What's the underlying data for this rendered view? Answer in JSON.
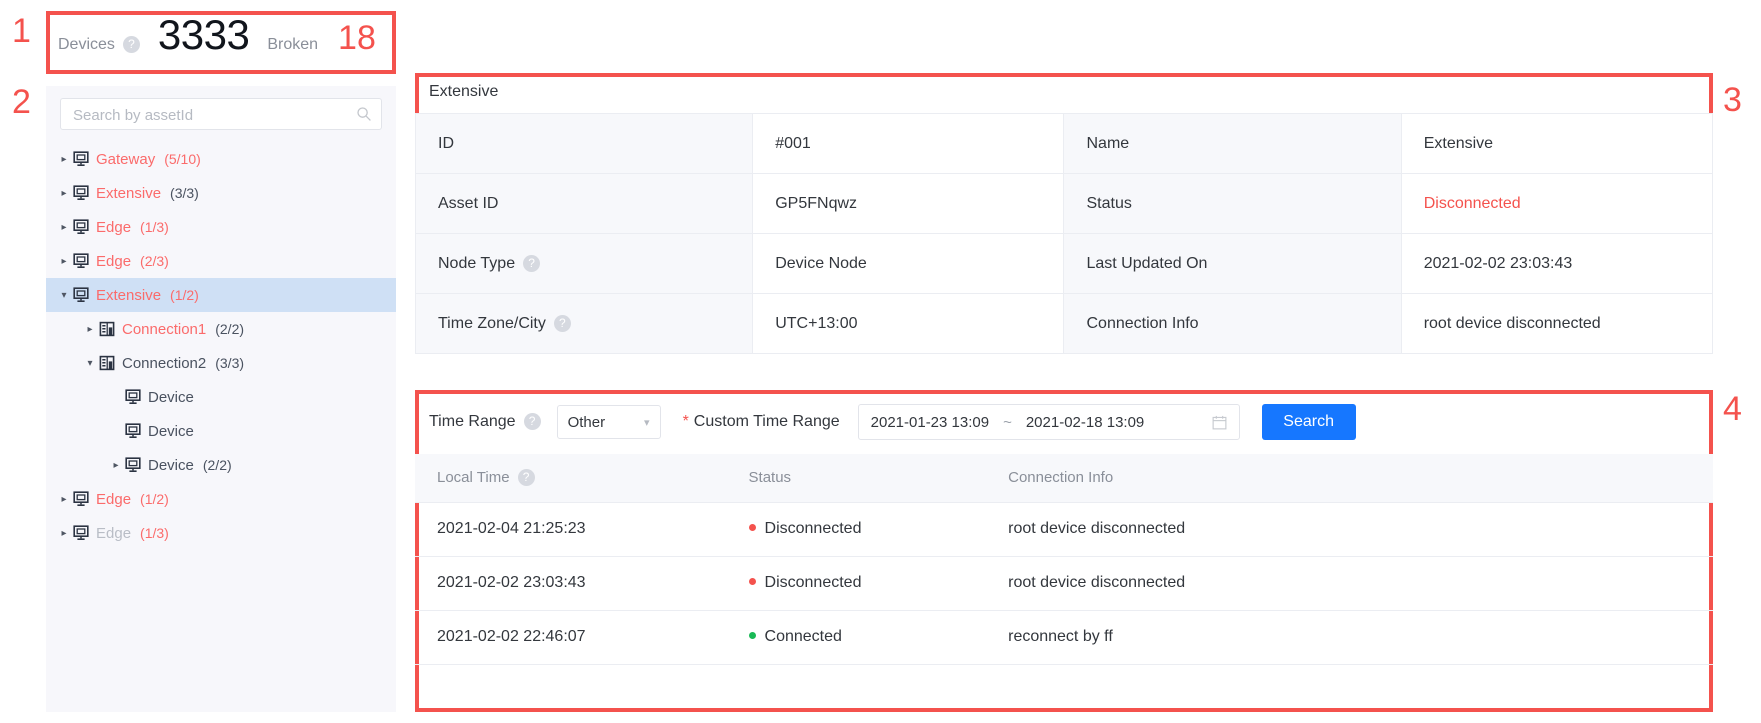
{
  "annotations": [
    {
      "num": "1"
    },
    {
      "num": "2"
    },
    {
      "num": "3"
    },
    {
      "num": "4"
    }
  ],
  "summary": {
    "devices_label": "Devices",
    "help_glyph": "?",
    "devices_count": "3333",
    "broken_label": "Broken",
    "broken_count": "18",
    "broken_color": "#f4524d"
  },
  "sidebar": {
    "search": {
      "placeholder": "Search by assetId",
      "value": "",
      "icon": "search-icon"
    },
    "tree": [
      {
        "label": "Gateway",
        "count": "(5/10)",
        "depth": 0,
        "caret": "right",
        "icon": "device-icon",
        "label_color": "red",
        "count_color": "red",
        "selected": false
      },
      {
        "label": "Extensive",
        "count": "(3/3)",
        "depth": 0,
        "caret": "right",
        "icon": "device-icon",
        "label_color": "red",
        "count_color": "dark",
        "selected": false
      },
      {
        "label": "Edge",
        "count": "(1/3)",
        "depth": 0,
        "caret": "right",
        "icon": "device-icon",
        "label_color": "red",
        "count_color": "red",
        "selected": false
      },
      {
        "label": "Edge",
        "count": "(2/3)",
        "depth": 0,
        "caret": "right",
        "icon": "device-icon",
        "label_color": "red",
        "count_color": "red",
        "selected": false
      },
      {
        "label": "Extensive",
        "count": "(1/2)",
        "depth": 0,
        "caret": "down",
        "icon": "device-icon",
        "label_color": "red",
        "count_color": "red",
        "selected": true
      },
      {
        "label": "Connection1",
        "count": "(2/2)",
        "depth": 1,
        "caret": "right",
        "icon": "connection-icon",
        "label_color": "red",
        "count_color": "dark",
        "selected": false
      },
      {
        "label": "Connection2",
        "count": "(3/3)",
        "depth": 1,
        "caret": "down",
        "icon": "connection-icon",
        "label_color": "dark",
        "count_color": "dark",
        "selected": false
      },
      {
        "label": "Device",
        "count": "",
        "depth": 2,
        "caret": "none",
        "icon": "device-icon",
        "label_color": "dark",
        "count_color": "dark",
        "selected": false
      },
      {
        "label": "Device",
        "count": "",
        "depth": 2,
        "caret": "none",
        "icon": "device-icon",
        "label_color": "dark",
        "count_color": "dark",
        "selected": false
      },
      {
        "label": "Device",
        "count": "(2/2)",
        "depth": 2,
        "caret": "right",
        "icon": "device-icon",
        "label_color": "dark",
        "count_color": "dark",
        "selected": false
      },
      {
        "label": "Edge",
        "count": "(1/2)",
        "depth": 0,
        "caret": "right",
        "icon": "device-icon",
        "label_color": "red",
        "count_color": "red",
        "selected": false
      },
      {
        "label": "Edge",
        "count": "(1/3)",
        "depth": 0,
        "caret": "right",
        "icon": "device-icon",
        "label_color": "gray",
        "count_color": "red",
        "selected": false
      }
    ]
  },
  "detail": {
    "title": "Extensive",
    "rows": [
      {
        "k1": "ID",
        "k1_help": false,
        "v1": "#001",
        "v1_danger": false,
        "k2": "Name",
        "v2": "Extensive",
        "v2_danger": false
      },
      {
        "k1": "Asset ID",
        "k1_help": false,
        "v1": "GP5FNqwz",
        "v1_danger": false,
        "k2": "Status",
        "v2": "Disconnected",
        "v2_danger": true
      },
      {
        "k1": "Node Type",
        "k1_help": true,
        "v1": "Device Node",
        "v1_danger": false,
        "k2": "Last Updated On",
        "v2": "2021-02-02 23:03:43",
        "v2_danger": false
      },
      {
        "k1": "Time Zone/City",
        "k1_help": true,
        "v1": "UTC+13:00",
        "v1_danger": false,
        "k2": "Connection Info",
        "v2": "root device disconnected",
        "v2_danger": false
      }
    ],
    "help_glyph": "?"
  },
  "logpanel": {
    "filter": {
      "time_range_label": "Time Range",
      "help_glyph": "?",
      "select_value": "Other",
      "select_options": [
        "Other"
      ],
      "chevron": "⌄",
      "required_mark": "*",
      "custom_range_label": "Custom Time Range",
      "date_start": "2021-01-23 13:09",
      "date_sep": "~",
      "date_end": "2021-02-18 13:09",
      "calendar_icon": "calendar-icon",
      "search_button": "Search"
    },
    "columns": [
      {
        "label": "Local Time",
        "help": true
      },
      {
        "label": "Status",
        "help": false
      },
      {
        "label": "Connection Info",
        "help": false
      }
    ],
    "help_glyph": "?",
    "rows": [
      {
        "time": "2021-02-04 21:25:23",
        "status": "Disconnected",
        "status_color": "red",
        "info": "root device disconnected"
      },
      {
        "time": "2021-02-02 23:03:43",
        "status": "Disconnected",
        "status_color": "red",
        "info": "root device disconnected"
      },
      {
        "time": "2021-02-02 22:46:07",
        "status": "Connected",
        "status_color": "green",
        "info": "reconnect by ff"
      }
    ]
  }
}
